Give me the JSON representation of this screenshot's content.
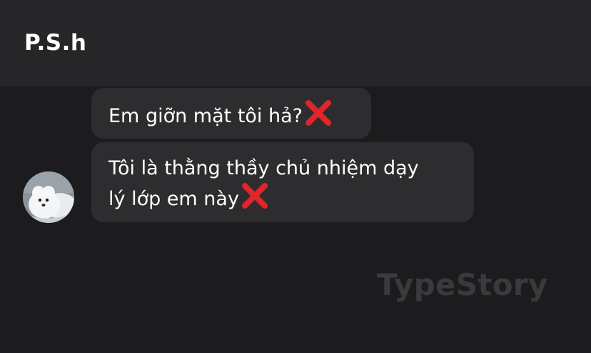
{
  "header": {
    "title": "P.S.h"
  },
  "messages": [
    {
      "line1": "Em giỡn mặt tôi hả?",
      "line2": "",
      "trailing_icon": "cross-mark-icon"
    },
    {
      "line1": "Tôi là thằng thầy chủ nhiệm dạy",
      "line2": "lý lớp em này",
      "trailing_icon": "cross-mark-icon"
    }
  ],
  "avatar": {
    "icon": "white-dog-avatar"
  },
  "watermark": {
    "text": "TypeStory"
  },
  "colors": {
    "background": "#1c1c1e",
    "header_background": "#262628",
    "bubble": "#2d2d30",
    "text": "#ffffff",
    "cross_mark": "#e0262a",
    "watermark": "#3a3a3c"
  }
}
